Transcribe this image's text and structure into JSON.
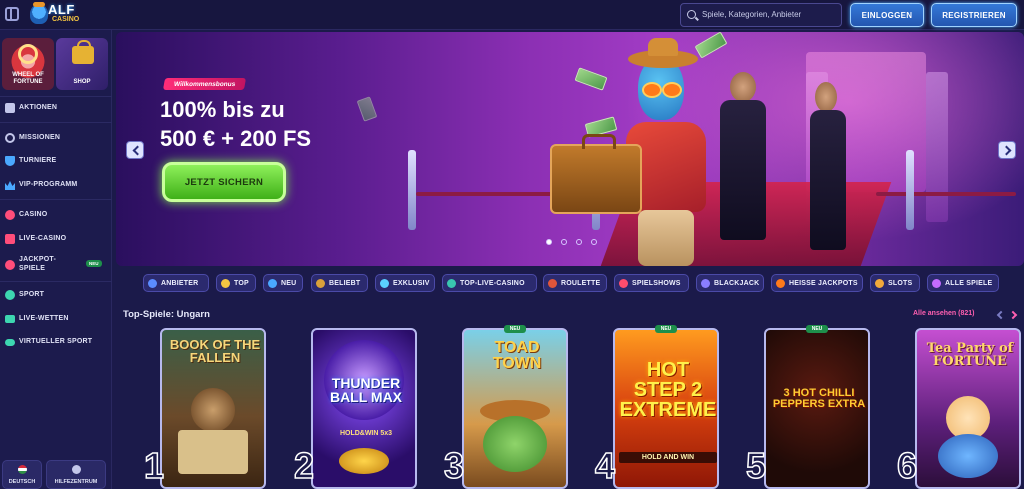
{
  "header": {
    "logo_text": "ALF",
    "logo_sub": "CASINO",
    "search_placeholder": "Spiele, Kategorien, Anbieter",
    "login_label": "EINLOGGEN",
    "register_label": "REGISTRIEREN"
  },
  "sidebar": {
    "promos": [
      {
        "label": "WHEEL OF FORTUNE"
      },
      {
        "label": "SHOP"
      }
    ],
    "items": [
      {
        "label": "AKTIONEN",
        "icon": "gift-icon"
      },
      {
        "label": "MISSIONEN",
        "icon": "target-icon"
      },
      {
        "label": "TURNIERE",
        "icon": "trophy-icon"
      },
      {
        "label": "VIP-PROGRAMM",
        "icon": "crown-icon"
      },
      {
        "label": "CASINO",
        "icon": "cherry-icon"
      },
      {
        "label": "LIVE-CASINO",
        "icon": "live-cards-icon"
      },
      {
        "label": "JACKPOT-SPIELE",
        "icon": "coins-icon",
        "badge": "NEU"
      },
      {
        "label": "SPORT",
        "icon": "ball-icon"
      },
      {
        "label": "LIVE-WETTEN",
        "icon": "live-icon"
      },
      {
        "label": "VIRTUELLER SPORT",
        "icon": "gamepad-icon"
      }
    ],
    "language_label": "DEUTSCH",
    "help_label": "HILFEZENTRUM"
  },
  "banner": {
    "tag": "Willkommensbonus",
    "headline_line1": "100% bis zu",
    "headline_line2": "500 € + 200 FS",
    "cta_label": "JETZT SICHERN",
    "slides": 4,
    "active_slide": 1
  },
  "categories": [
    {
      "label": "ANBIETER",
      "color": "#5b8cff"
    },
    {
      "label": "TOP",
      "color": "#f4c542"
    },
    {
      "label": "NEU",
      "color": "#4aa8ff"
    },
    {
      "label": "BELIEBT",
      "color": "#d9a13a"
    },
    {
      "label": "EXKLUSIV",
      "color": "#5ad1ff"
    },
    {
      "label": "TOP-LIVE-CASINO",
      "color": "#39c6b0"
    },
    {
      "label": "ROULETTE",
      "color": "#e0553b"
    },
    {
      "label": "SPIELSHOWS",
      "color": "#ff4d6d"
    },
    {
      "label": "BLACKJACK",
      "color": "#8a7dff"
    },
    {
      "label": "HEISSE JACKPOTS",
      "color": "#ff7a1a"
    },
    {
      "label": "SLOTS",
      "color": "#f2a93b"
    },
    {
      "label": "ALLE SPIELE",
      "color": "#c36bff"
    }
  ],
  "top_games": {
    "title": "Top-Spiele: Ungarn",
    "see_all": "Alle ansehen (821)",
    "new_label": "NEU",
    "games": [
      {
        "rank": "1",
        "title": "BOOK OF THE FALLEN",
        "is_new": false
      },
      {
        "rank": "2",
        "title": "THUNDER BALL MAX",
        "subtitle": "HOLD&WIN 5x3",
        "is_new": false
      },
      {
        "rank": "3",
        "title": "TOAD TOWN",
        "is_new": true
      },
      {
        "rank": "4",
        "title": "HOT STEP 2 EXTREME",
        "subtitle": "HOLD AND WIN",
        "is_new": true
      },
      {
        "rank": "5",
        "title": "3 HOT CHILLI PEPPERS EXTRA",
        "is_new": true
      },
      {
        "rank": "6",
        "title": "Tea Party of FORTUNE",
        "is_new": false
      }
    ]
  }
}
